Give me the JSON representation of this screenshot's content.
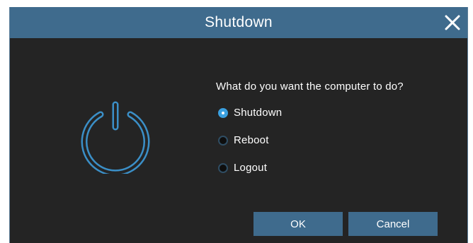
{
  "dialog": {
    "title": "Shutdown",
    "close_icon": "close-icon",
    "power_icon": "power-icon",
    "prompt": "What do you want the computer to do?",
    "options": [
      {
        "label": "Shutdown",
        "selected": true
      },
      {
        "label": "Reboot",
        "selected": false
      },
      {
        "label": "Logout",
        "selected": false
      }
    ],
    "ok_label": "OK",
    "cancel_label": "Cancel"
  },
  "colors": {
    "titlebar": "#3f6b8d",
    "background": "#242424",
    "accent": "#3aa0e0",
    "power_icon": "#3b8fc7"
  }
}
